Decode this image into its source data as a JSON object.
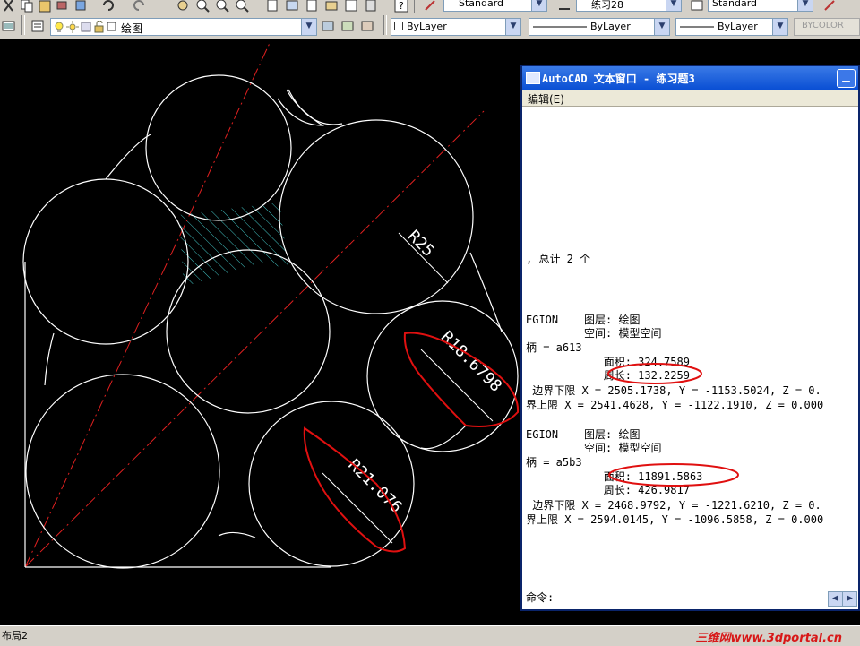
{
  "toolbar_top": {
    "text_style": "Standard",
    "dim_style": "练习28",
    "table_style": "Standard"
  },
  "toolbar_layer": {
    "layer_name": "绘图",
    "color": "ByLayer",
    "linetype": "ByLayer",
    "lineweight": "ByLayer",
    "plot_style": "BYCOLOR"
  },
  "drawing": {
    "dim_labels": [
      "R25",
      "R18.6798",
      "R21.076"
    ]
  },
  "text_window": {
    "title": "AutoCAD 文本窗口 - 练习题3",
    "menu_edit": "编辑(E)",
    "lines": [
      ", 总计 2 个",
      "EGION    图层: 绘图",
      "         空间: 模型空间",
      "柄 = a613",
      "            面积: 324.7589",
      "            周长: 132.2259",
      " 边界下限 X = 2505.1738, Y = -1153.5024, Z = 0.",
      "界上限 X = 2541.4628, Y = -1122.1910, Z = 0.000",
      "EGION    图层: 绘图",
      "         空间: 模型空间",
      "柄 = a5b3",
      "            面积: 11891.5863",
      "            周长: 426.9817",
      " 边界下限 X = 2468.9792, Y = -1221.6210, Z = 0.",
      "界上限 X = 2594.0145, Y = -1096.5858, Z = 0.000"
    ],
    "command_prompt": "命令:"
  },
  "status": {
    "layout_tab": "布局2",
    "watermark": "三维网www.3dportal.cn"
  },
  "colors": {
    "background": "#000000",
    "geometry": "#ffffff",
    "centerline": "#e02020",
    "hatch": "#40c0c0",
    "annotation": "#e01010"
  }
}
